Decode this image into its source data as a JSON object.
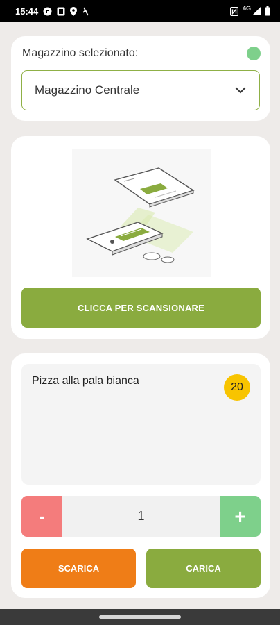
{
  "status_bar": {
    "time": "15:44",
    "network": "4G"
  },
  "warehouse": {
    "label": "Magazzino selezionato:",
    "selected": "Magazzino Centrale",
    "status_color": "#7ed08b"
  },
  "scan": {
    "button_label": "CLICCA PER SCANSIONARE"
  },
  "product": {
    "name": "Pizza alla pala bianca",
    "stock": "20"
  },
  "quantity": {
    "minus_label": "-",
    "value": "1",
    "plus_label": "+"
  },
  "actions": {
    "unload_label": "SCARICA",
    "load_label": "CARICA"
  },
  "colors": {
    "accent_green": "#8aab3f",
    "orange": "#ef7d17",
    "red": "#f47c7c",
    "light_green": "#7ed08b",
    "badge_yellow": "#f8c400"
  }
}
